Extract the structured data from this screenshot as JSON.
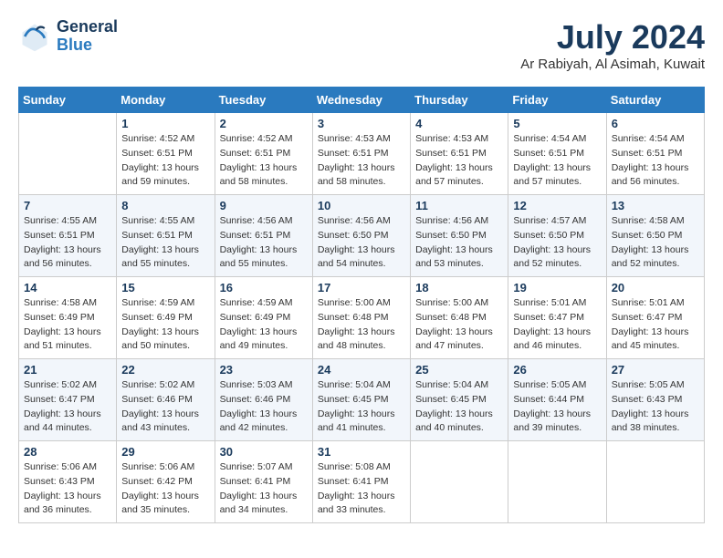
{
  "header": {
    "logo_line1": "General",
    "logo_line2": "Blue",
    "month": "July 2024",
    "location": "Ar Rabiyah, Al Asimah, Kuwait"
  },
  "weekdays": [
    "Sunday",
    "Monday",
    "Tuesday",
    "Wednesday",
    "Thursday",
    "Friday",
    "Saturday"
  ],
  "weeks": [
    [
      {
        "day": "",
        "sunrise": "",
        "sunset": "",
        "daylight": ""
      },
      {
        "day": "1",
        "sunrise": "Sunrise: 4:52 AM",
        "sunset": "Sunset: 6:51 PM",
        "daylight": "Daylight: 13 hours and 59 minutes."
      },
      {
        "day": "2",
        "sunrise": "Sunrise: 4:52 AM",
        "sunset": "Sunset: 6:51 PM",
        "daylight": "Daylight: 13 hours and 58 minutes."
      },
      {
        "day": "3",
        "sunrise": "Sunrise: 4:53 AM",
        "sunset": "Sunset: 6:51 PM",
        "daylight": "Daylight: 13 hours and 58 minutes."
      },
      {
        "day": "4",
        "sunrise": "Sunrise: 4:53 AM",
        "sunset": "Sunset: 6:51 PM",
        "daylight": "Daylight: 13 hours and 57 minutes."
      },
      {
        "day": "5",
        "sunrise": "Sunrise: 4:54 AM",
        "sunset": "Sunset: 6:51 PM",
        "daylight": "Daylight: 13 hours and 57 minutes."
      },
      {
        "day": "6",
        "sunrise": "Sunrise: 4:54 AM",
        "sunset": "Sunset: 6:51 PM",
        "daylight": "Daylight: 13 hours and 56 minutes."
      }
    ],
    [
      {
        "day": "7",
        "sunrise": "Sunrise: 4:55 AM",
        "sunset": "Sunset: 6:51 PM",
        "daylight": "Daylight: 13 hours and 56 minutes."
      },
      {
        "day": "8",
        "sunrise": "Sunrise: 4:55 AM",
        "sunset": "Sunset: 6:51 PM",
        "daylight": "Daylight: 13 hours and 55 minutes."
      },
      {
        "day": "9",
        "sunrise": "Sunrise: 4:56 AM",
        "sunset": "Sunset: 6:51 PM",
        "daylight": "Daylight: 13 hours and 55 minutes."
      },
      {
        "day": "10",
        "sunrise": "Sunrise: 4:56 AM",
        "sunset": "Sunset: 6:50 PM",
        "daylight": "Daylight: 13 hours and 54 minutes."
      },
      {
        "day": "11",
        "sunrise": "Sunrise: 4:56 AM",
        "sunset": "Sunset: 6:50 PM",
        "daylight": "Daylight: 13 hours and 53 minutes."
      },
      {
        "day": "12",
        "sunrise": "Sunrise: 4:57 AM",
        "sunset": "Sunset: 6:50 PM",
        "daylight": "Daylight: 13 hours and 52 minutes."
      },
      {
        "day": "13",
        "sunrise": "Sunrise: 4:58 AM",
        "sunset": "Sunset: 6:50 PM",
        "daylight": "Daylight: 13 hours and 52 minutes."
      }
    ],
    [
      {
        "day": "14",
        "sunrise": "Sunrise: 4:58 AM",
        "sunset": "Sunset: 6:49 PM",
        "daylight": "Daylight: 13 hours and 51 minutes."
      },
      {
        "day": "15",
        "sunrise": "Sunrise: 4:59 AM",
        "sunset": "Sunset: 6:49 PM",
        "daylight": "Daylight: 13 hours and 50 minutes."
      },
      {
        "day": "16",
        "sunrise": "Sunrise: 4:59 AM",
        "sunset": "Sunset: 6:49 PM",
        "daylight": "Daylight: 13 hours and 49 minutes."
      },
      {
        "day": "17",
        "sunrise": "Sunrise: 5:00 AM",
        "sunset": "Sunset: 6:48 PM",
        "daylight": "Daylight: 13 hours and 48 minutes."
      },
      {
        "day": "18",
        "sunrise": "Sunrise: 5:00 AM",
        "sunset": "Sunset: 6:48 PM",
        "daylight": "Daylight: 13 hours and 47 minutes."
      },
      {
        "day": "19",
        "sunrise": "Sunrise: 5:01 AM",
        "sunset": "Sunset: 6:47 PM",
        "daylight": "Daylight: 13 hours and 46 minutes."
      },
      {
        "day": "20",
        "sunrise": "Sunrise: 5:01 AM",
        "sunset": "Sunset: 6:47 PM",
        "daylight": "Daylight: 13 hours and 45 minutes."
      }
    ],
    [
      {
        "day": "21",
        "sunrise": "Sunrise: 5:02 AM",
        "sunset": "Sunset: 6:47 PM",
        "daylight": "Daylight: 13 hours and 44 minutes."
      },
      {
        "day": "22",
        "sunrise": "Sunrise: 5:02 AM",
        "sunset": "Sunset: 6:46 PM",
        "daylight": "Daylight: 13 hours and 43 minutes."
      },
      {
        "day": "23",
        "sunrise": "Sunrise: 5:03 AM",
        "sunset": "Sunset: 6:46 PM",
        "daylight": "Daylight: 13 hours and 42 minutes."
      },
      {
        "day": "24",
        "sunrise": "Sunrise: 5:04 AM",
        "sunset": "Sunset: 6:45 PM",
        "daylight": "Daylight: 13 hours and 41 minutes."
      },
      {
        "day": "25",
        "sunrise": "Sunrise: 5:04 AM",
        "sunset": "Sunset: 6:45 PM",
        "daylight": "Daylight: 13 hours and 40 minutes."
      },
      {
        "day": "26",
        "sunrise": "Sunrise: 5:05 AM",
        "sunset": "Sunset: 6:44 PM",
        "daylight": "Daylight: 13 hours and 39 minutes."
      },
      {
        "day": "27",
        "sunrise": "Sunrise: 5:05 AM",
        "sunset": "Sunset: 6:43 PM",
        "daylight": "Daylight: 13 hours and 38 minutes."
      }
    ],
    [
      {
        "day": "28",
        "sunrise": "Sunrise: 5:06 AM",
        "sunset": "Sunset: 6:43 PM",
        "daylight": "Daylight: 13 hours and 36 minutes."
      },
      {
        "day": "29",
        "sunrise": "Sunrise: 5:06 AM",
        "sunset": "Sunset: 6:42 PM",
        "daylight": "Daylight: 13 hours and 35 minutes."
      },
      {
        "day": "30",
        "sunrise": "Sunrise: 5:07 AM",
        "sunset": "Sunset: 6:41 PM",
        "daylight": "Daylight: 13 hours and 34 minutes."
      },
      {
        "day": "31",
        "sunrise": "Sunrise: 5:08 AM",
        "sunset": "Sunset: 6:41 PM",
        "daylight": "Daylight: 13 hours and 33 minutes."
      },
      {
        "day": "",
        "sunrise": "",
        "sunset": "",
        "daylight": ""
      },
      {
        "day": "",
        "sunrise": "",
        "sunset": "",
        "daylight": ""
      },
      {
        "day": "",
        "sunrise": "",
        "sunset": "",
        "daylight": ""
      }
    ]
  ]
}
